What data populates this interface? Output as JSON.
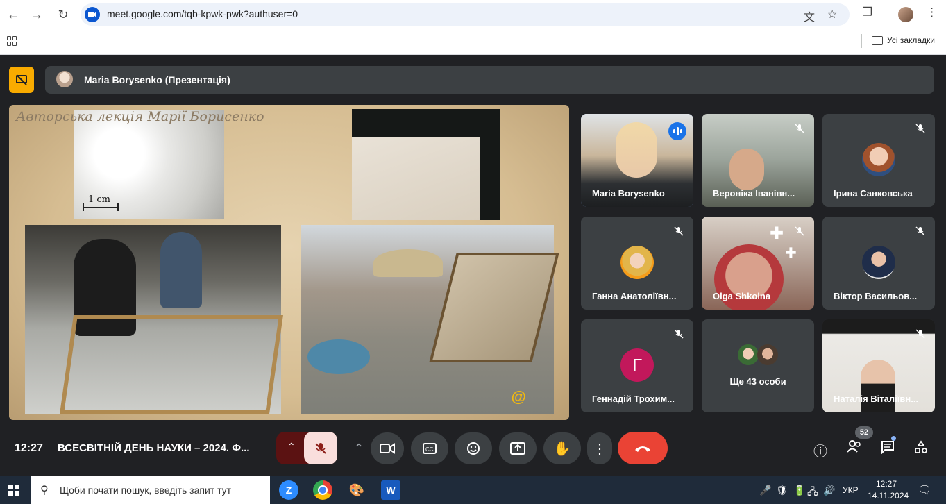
{
  "browser": {
    "url": "meet.google.com/tqb-kpwk-pwk?authuser=0",
    "bookmarks_label": "Усі закладки"
  },
  "meet": {
    "presenter_label": "Maria Borysenko (Презентація)",
    "slide": {
      "title": "Авторська лекція Марії Борисенко",
      "scale_label": "1 cm"
    },
    "participants": [
      {
        "name": "Maria Borysenko",
        "speaking": true
      },
      {
        "name": "Вероніка Іванівн...",
        "muted": true
      },
      {
        "name": "Ірина Санковська",
        "muted": true
      },
      {
        "name": "Ганна Анатоліївн...",
        "muted": true
      },
      {
        "name": "Olga Shkolna",
        "muted": true
      },
      {
        "name": "Віктор Васильов...",
        "muted": true
      },
      {
        "name": "Геннадій Трохим...",
        "muted": true,
        "initial": "Г"
      },
      {
        "name": "Ще 43 особи"
      },
      {
        "name": "Наталія Віталіївн...",
        "muted": true
      }
    ],
    "clock": "12:27",
    "meeting_title": "ВСЕСВІТНІЙ ДЕНЬ НАУКИ – 2024. Ф...",
    "people_count": "52",
    "colors": {
      "hangup": "#ea4335",
      "mic_off_bg": "#f9dedc",
      "present_btn": "#f9ab00",
      "initial_avatar": "#c2185b"
    }
  },
  "taskbar": {
    "search_placeholder": "Щоби почати пошук, введіть запит тут",
    "language": "УКР",
    "time": "12:27",
    "date": "14.11.2024"
  }
}
